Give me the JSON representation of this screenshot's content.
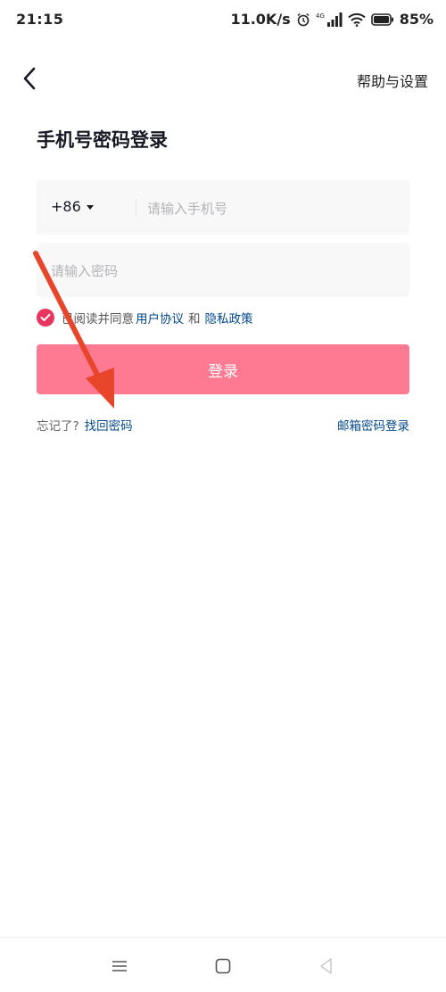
{
  "status_bar": {
    "time": "21:15",
    "net_speed": "11.0K/s",
    "network_type": "4G",
    "battery": "85%"
  },
  "header": {
    "back_icon": "chevron-left-icon",
    "help_label": "帮助与设置"
  },
  "page": {
    "title": "手机号密码登录"
  },
  "form": {
    "country_code": "+86",
    "phone_placeholder": "请输入手机号",
    "password_placeholder": "请输入密码"
  },
  "agreement": {
    "prefix": "已阅读并同意",
    "user_agreement": "用户协议",
    "and": "和",
    "privacy_policy": "隐私政策"
  },
  "login_button": "登录",
  "forgot": {
    "prefix": "忘记了?",
    "link": "找回密码"
  },
  "email_login": "邮箱密码登录",
  "colors": {
    "accent": "#fe7a92",
    "checkbox": "#e8345f",
    "link": "#04498d",
    "annotation_arrow": "#e8452a"
  }
}
